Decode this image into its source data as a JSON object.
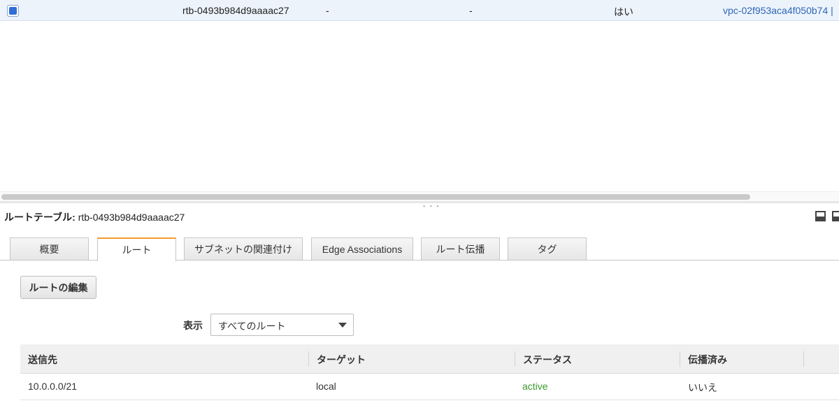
{
  "route_tables": {
    "selected_row": {
      "selected": true,
      "route_table_id": "rtb-0493b984d9aaaac27",
      "col_dash_1": "-",
      "col_dash_2": "-",
      "main": "はい",
      "vpc": "vpc-02f953aca4f050b74 |"
    }
  },
  "detail": {
    "title_label": "ルートテーブル:",
    "title_value": "rtb-0493b984d9aaaac27",
    "tabs": [
      {
        "label": "概要",
        "active": false
      },
      {
        "label": "ルート",
        "active": true
      },
      {
        "label": "サブネットの関連付け",
        "active": false
      },
      {
        "label": "Edge Associations",
        "active": false
      },
      {
        "label": "ルート伝播",
        "active": false
      },
      {
        "label": "タグ",
        "active": false
      }
    ],
    "edit_button": "ルートの編集",
    "filter": {
      "label": "表示",
      "selected": "すべてのルート"
    },
    "routes_table": {
      "columns": [
        "送信先",
        "ターゲット",
        "ステータス",
        "伝播済み"
      ],
      "rows": [
        {
          "destination": "10.0.0.0/21",
          "target": "local",
          "status": "active",
          "propagated": "いいえ"
        }
      ]
    }
  },
  "colors": {
    "link": "#2b67b8",
    "status_active": "#3a9a2a",
    "tab_active_accent": "#f29d2e",
    "checkbox_fill": "#2f6fd6"
  }
}
